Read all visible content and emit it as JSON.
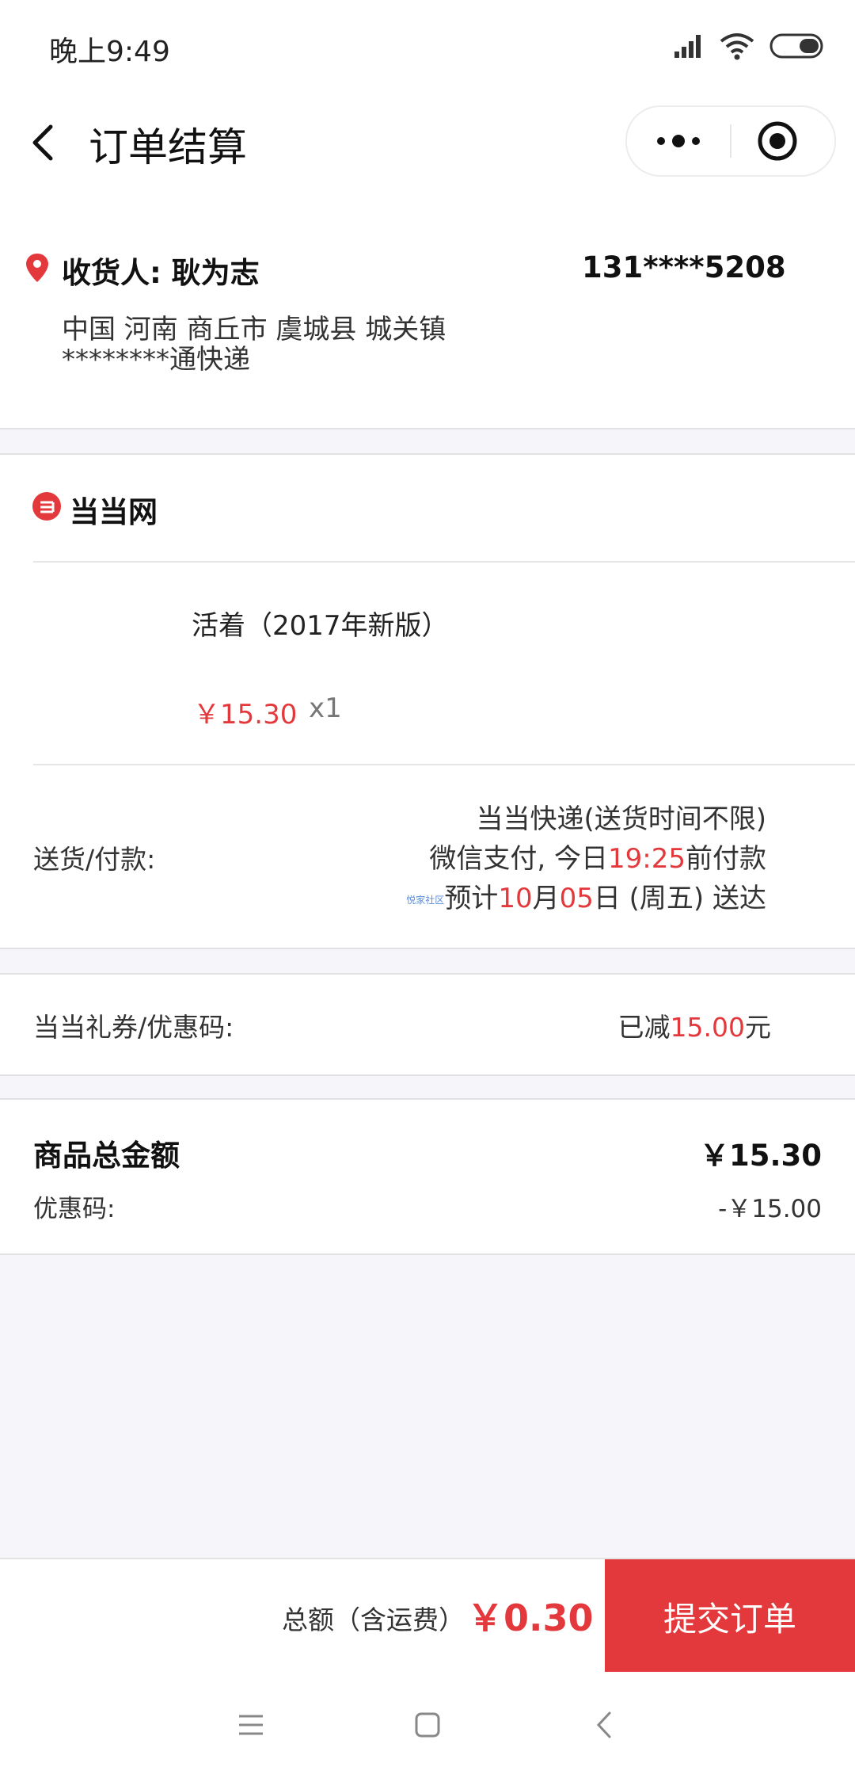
{
  "status_bar": {
    "time": "晚上9:49"
  },
  "header": {
    "title": "订单结算"
  },
  "address": {
    "recipient": "收货人: 耿为志",
    "phone": "131****5208",
    "line1": "中国 河南 商丘市 虞城县 城关镇",
    "line2": "********通快递"
  },
  "store": {
    "name": "当当网",
    "product": {
      "name": "活着（2017年新版）",
      "price": "￥15.30",
      "quantity": "x1"
    },
    "delivery": {
      "label": "送货/付款:",
      "line1": "当当快递(送货时间不限)",
      "line2_prefix": "微信支付, 今日",
      "line2_time": "19:25",
      "line2_suffix": "前付款",
      "line3_watermark": "悦家社区",
      "line3_prefix": "预计",
      "line3_month": "10",
      "line3_mid": "月",
      "line3_day": "05",
      "line3_suffix": "日 (周五) 送达"
    }
  },
  "coupon": {
    "label": "当当礼券/优惠码:",
    "value_prefix": "已减",
    "value_amount": "15.00",
    "value_suffix": "元"
  },
  "summary": {
    "total_label": "商品总金额",
    "total_value": "￥15.30",
    "discount_label": "优惠码:",
    "discount_value": "-￥15.00"
  },
  "bottom": {
    "total_label": "总额（含运费）",
    "total_value": "￥0.30",
    "submit_label": "提交订单"
  },
  "colors": {
    "accent": "#e4393c"
  }
}
